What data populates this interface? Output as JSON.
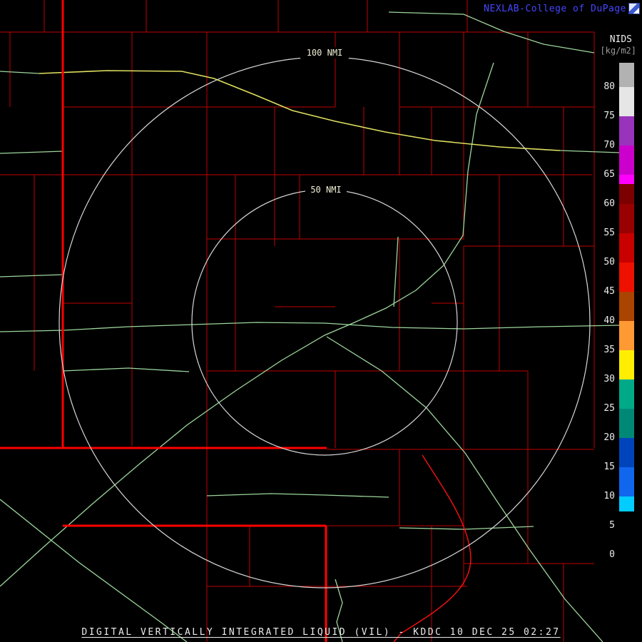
{
  "header": {
    "brand": "NEXLAB-College of DuPage",
    "product": "NIDS",
    "units": "[kg/m2]"
  },
  "rings": {
    "outer_label": "100 NMI",
    "inner_label": "50 NMI"
  },
  "footer": {
    "caption": "DIGITAL VERTICALLY INTEGRATED LIQUID (VIL) - KDDC 10 DEC 25 02:27"
  },
  "colorbar": {
    "unit_label": "[kg/m2]",
    "ticks": [
      "80",
      "75",
      "70",
      "65",
      "60",
      "55",
      "50",
      "45",
      "40",
      "35",
      "30",
      "25",
      "20",
      "15",
      "10",
      "5",
      "0"
    ],
    "segments": [
      {
        "h": 34,
        "color": "#b2b2b2"
      },
      {
        "h": 41,
        "color": "#e6e6e6"
      },
      {
        "h": 41,
        "color": "#9933bb"
      },
      {
        "h": 41,
        "color": "#cc00cc"
      },
      {
        "h": 13,
        "color": "#ff00ff"
      },
      {
        "h": 28,
        "color": "#7c0000"
      },
      {
        "h": 41,
        "color": "#990000"
      },
      {
        "h": 41,
        "color": "#c80000"
      },
      {
        "h": 41,
        "color": "#ee1100"
      },
      {
        "h": 41,
        "color": "#aa4400"
      },
      {
        "h": 41,
        "color": "#ff9933"
      },
      {
        "h": 41,
        "color": "#ffee00"
      },
      {
        "h": 41,
        "color": "#00aa88"
      },
      {
        "h": 41,
        "color": "#008877"
      },
      {
        "h": 41,
        "color": "#0044bb"
      },
      {
        "h": 41,
        "color": "#1166ee"
      },
      {
        "h": 21,
        "color": "#00ccff"
      },
      {
        "h": 81,
        "color": "#000000"
      }
    ]
  },
  "map": {
    "site": "KDDC",
    "colors": {
      "county": "#c00000",
      "highway_major": "#ff0000",
      "road": "#9cd69c",
      "interstate": "#e0e060",
      "red_route": "#ee1111",
      "ring": "#d8d8d8"
    }
  }
}
